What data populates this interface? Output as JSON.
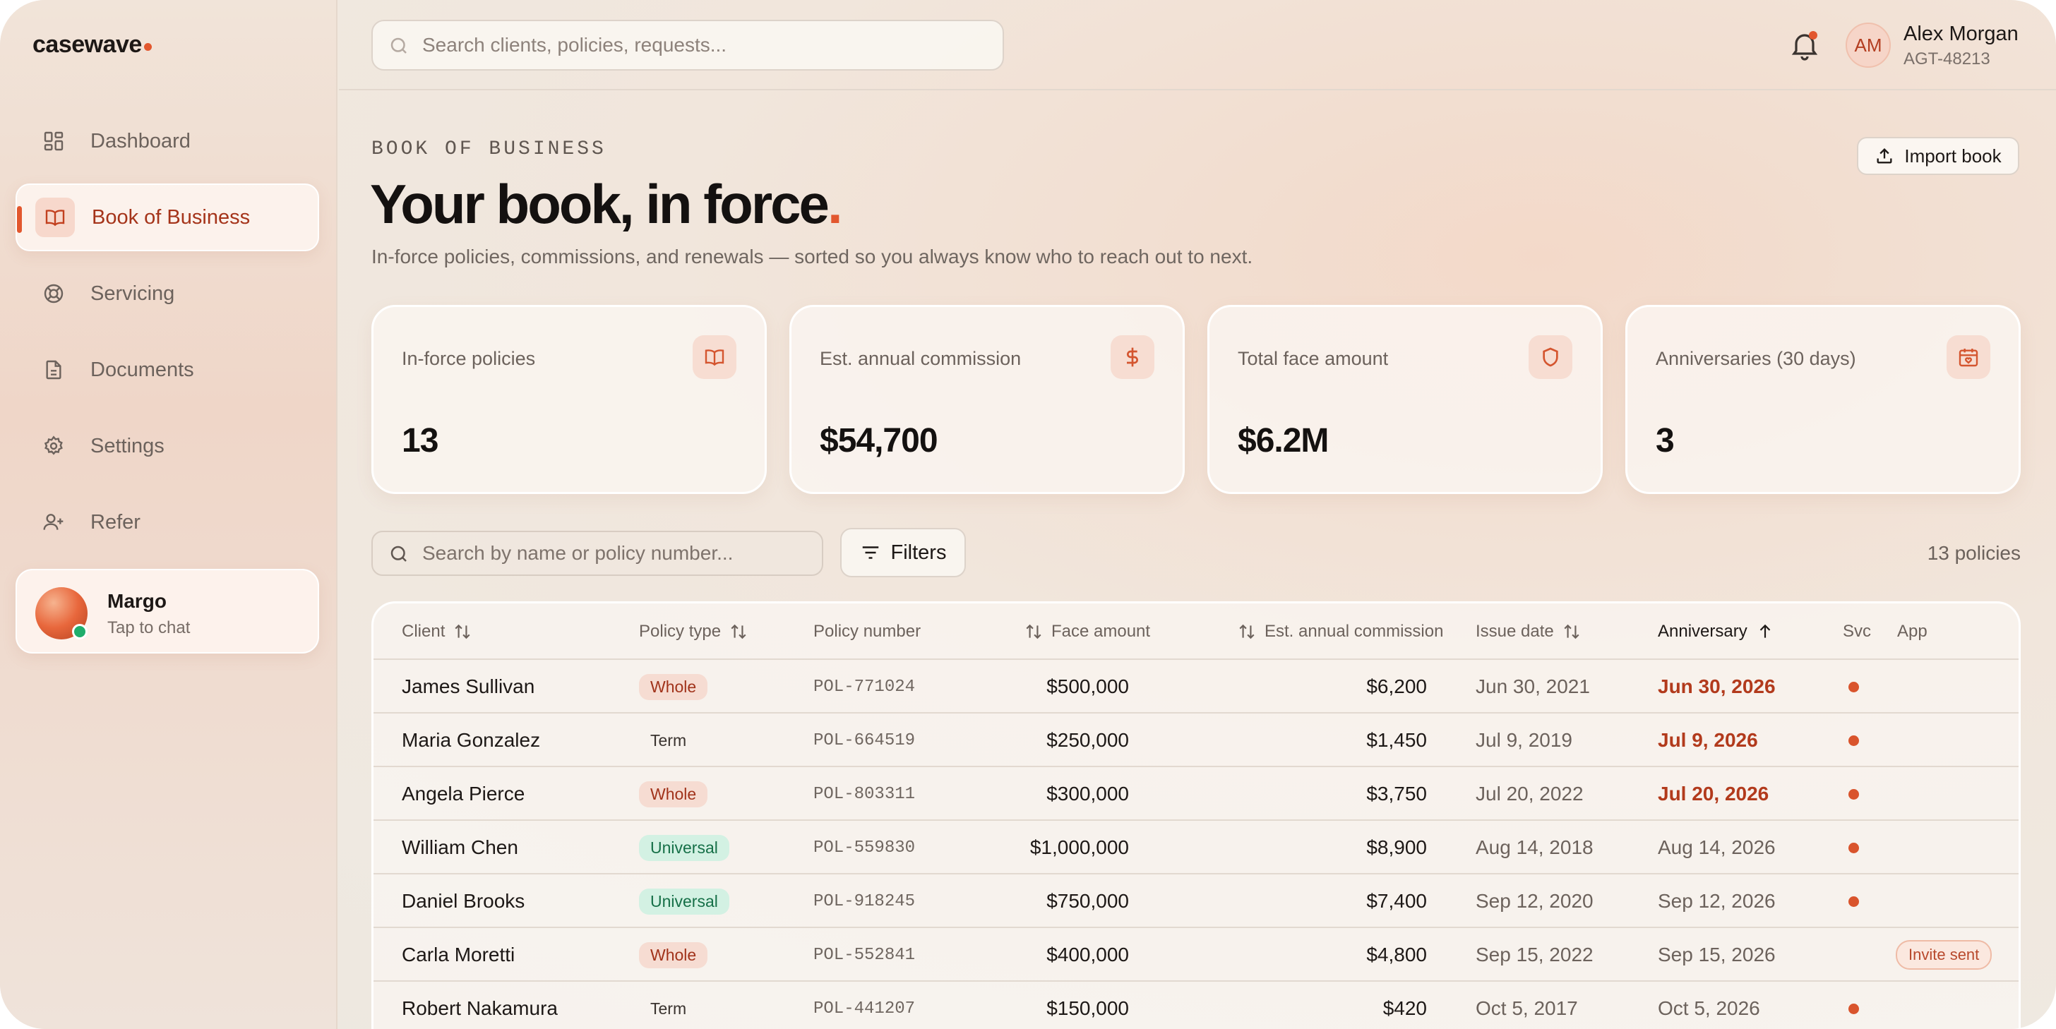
{
  "brand": {
    "name": "casewave",
    "accent": "#e2572e"
  },
  "sidebar": {
    "items": [
      {
        "label": "Dashboard",
        "icon": "grid-icon"
      },
      {
        "label": "Book of Business",
        "icon": "book-icon",
        "active": true
      },
      {
        "label": "Servicing",
        "icon": "lifebuoy-icon"
      },
      {
        "label": "Documents",
        "icon": "document-icon"
      },
      {
        "label": "Settings",
        "icon": "gear-icon"
      },
      {
        "label": "Refer",
        "icon": "user-plus-icon"
      }
    ],
    "chat": {
      "name": "Margo",
      "subtitle": "Tap to chat"
    }
  },
  "header": {
    "search_placeholder": "Search clients, policies, requests...",
    "user": {
      "initials": "AM",
      "name": "Alex Morgan",
      "id": "AGT-48213"
    }
  },
  "page": {
    "eyebrow": "BOOK OF BUSINESS",
    "title": "Your book, in force",
    "title_accent": ".",
    "subtitle": "In-force policies, commissions, and renewals — sorted so you always know who to reach out to next.",
    "import_label": "Import book"
  },
  "kpis": [
    {
      "label": "In-force policies",
      "value": "13",
      "icon": "book-icon"
    },
    {
      "label": "Est. annual commission",
      "value": "$54,700",
      "icon": "dollar-icon"
    },
    {
      "label": "Total face amount",
      "value": "$6.2M",
      "icon": "shield-icon"
    },
    {
      "label": "Anniversaries (30 days)",
      "value": "3",
      "icon": "calendar-heart-icon"
    }
  ],
  "table": {
    "search_placeholder": "Search by name or policy number...",
    "filters_label": "Filters",
    "count_label": "13 policies",
    "columns": {
      "client": "Client",
      "policy_type": "Policy type",
      "policy_number": "Policy number",
      "face_amount": "Face amount",
      "commission": "Est. annual commission",
      "issue_date": "Issue date",
      "anniversary": "Anniversary",
      "svc": "Svc",
      "app": "App"
    },
    "rows": [
      {
        "client": "James Sullivan",
        "type": "Whole",
        "policy": "POL-771024",
        "face": "$500,000",
        "commission": "$6,200",
        "issue": "Jun 30, 2021",
        "anniversary": "Jun 30, 2026",
        "hot": true,
        "svc": true,
        "app": ""
      },
      {
        "client": "Maria Gonzalez",
        "type": "Term",
        "policy": "POL-664519",
        "face": "$250,000",
        "commission": "$1,450",
        "issue": "Jul 9, 2019",
        "anniversary": "Jul 9, 2026",
        "hot": true,
        "svc": true,
        "app": ""
      },
      {
        "client": "Angela Pierce",
        "type": "Whole",
        "policy": "POL-803311",
        "face": "$300,000",
        "commission": "$3,750",
        "issue": "Jul 20, 2022",
        "anniversary": "Jul 20, 2026",
        "hot": true,
        "svc": true,
        "app": ""
      },
      {
        "client": "William Chen",
        "type": "Universal",
        "policy": "POL-559830",
        "face": "$1,000,000",
        "commission": "$8,900",
        "issue": "Aug 14, 2018",
        "anniversary": "Aug 14, 2026",
        "hot": false,
        "svc": true,
        "app": ""
      },
      {
        "client": "Daniel Brooks",
        "type": "Universal",
        "policy": "POL-918245",
        "face": "$750,000",
        "commission": "$7,400",
        "issue": "Sep 12, 2020",
        "anniversary": "Sep 12, 2026",
        "hot": false,
        "svc": true,
        "app": ""
      },
      {
        "client": "Carla Moretti",
        "type": "Whole",
        "policy": "POL-552841",
        "face": "$400,000",
        "commission": "$4,800",
        "issue": "Sep 15, 2022",
        "anniversary": "Sep 15, 2026",
        "hot": false,
        "svc": false,
        "app": "Invite sent"
      },
      {
        "client": "Robert Nakamura",
        "type": "Term",
        "policy": "POL-441207",
        "face": "$150,000",
        "commission": "$420",
        "issue": "Oct 5, 2017",
        "anniversary": "Oct 5, 2026",
        "hot": false,
        "svc": true,
        "app": ""
      }
    ]
  }
}
